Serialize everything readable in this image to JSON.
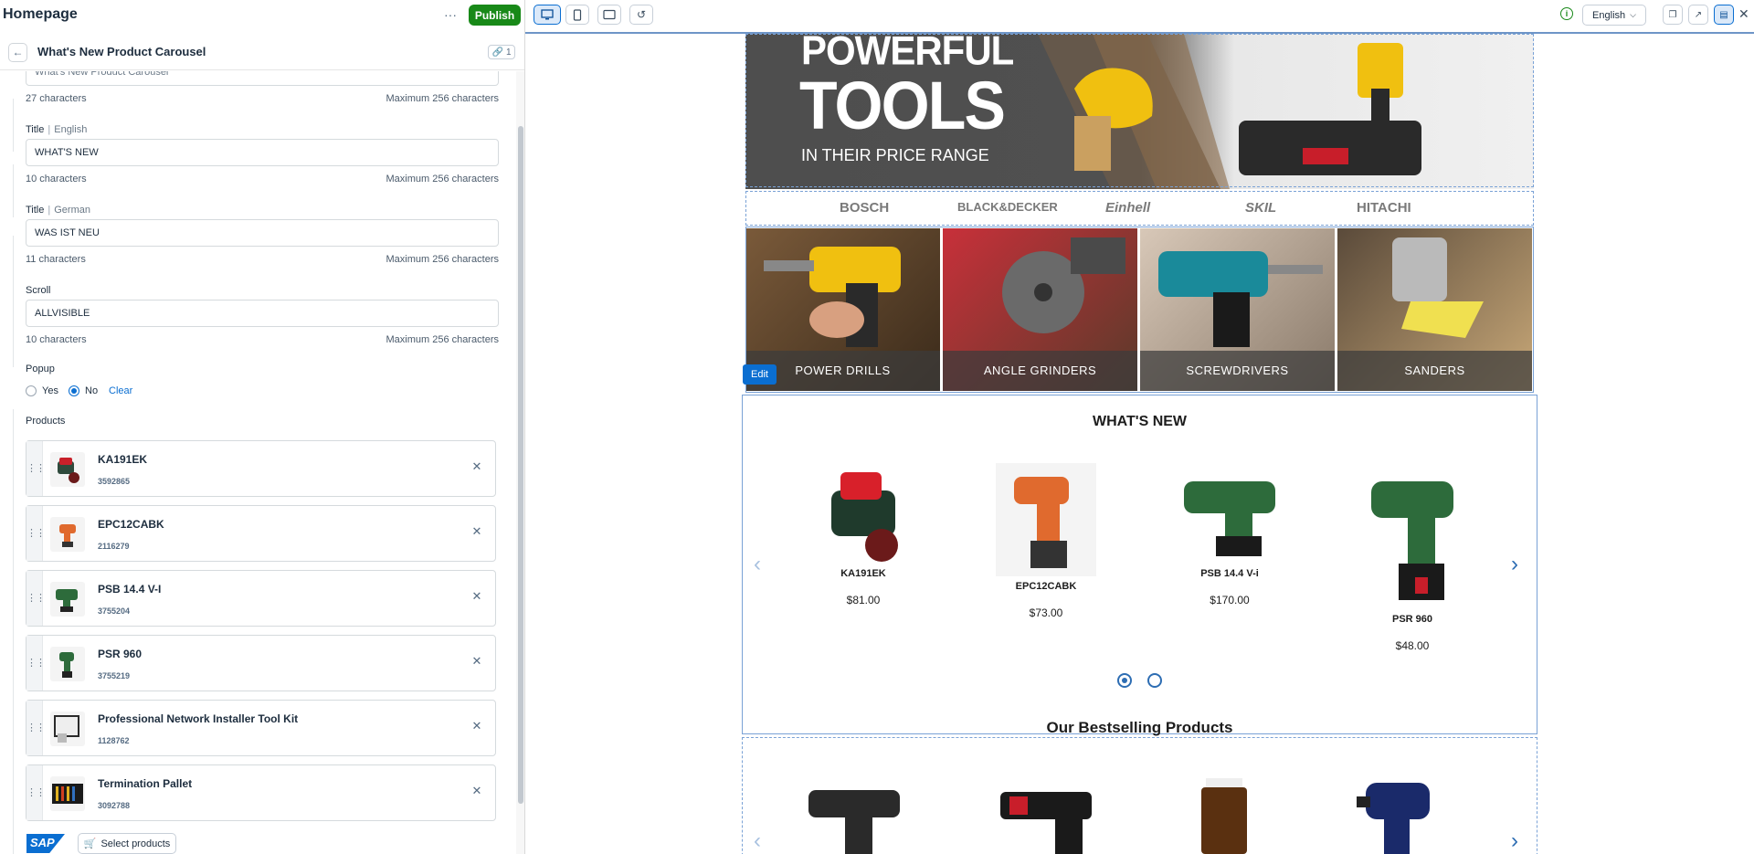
{
  "header": {
    "page_title": "Homepage",
    "more_label": "···",
    "publish_label": "Publish"
  },
  "component": {
    "title": "What's New Product Carousel",
    "link_count": "1"
  },
  "form": {
    "name_value": "What's New Product Carousel",
    "name_count": "27 characters",
    "max_label": "Maximum 256 characters",
    "title_en": {
      "label": "Title",
      "lang": "English",
      "value": "WHAT'S NEW",
      "count": "10 characters"
    },
    "title_de": {
      "label": "Title",
      "lang": "German",
      "value": "WAS IST NEU",
      "count": "11 characters"
    },
    "scroll": {
      "label": "Scroll",
      "value": "ALLVISIBLE",
      "count": "10 characters"
    },
    "popup": {
      "label": "Popup",
      "yes": "Yes",
      "no": "No",
      "clear": "Clear",
      "selected": "No"
    },
    "products_label": "Products",
    "products": [
      {
        "name": "KA191EK",
        "id": "3592865"
      },
      {
        "name": "EPC12CABK",
        "id": "2116279"
      },
      {
        "name": "PSB 14.4 V-I",
        "id": "3755204"
      },
      {
        "name": "PSR 960",
        "id": "3755219"
      },
      {
        "name": "Professional Network Installer Tool Kit",
        "id": "1128762"
      },
      {
        "name": "Termination Pallet",
        "id": "3092788"
      }
    ],
    "sap_logo": "SAP",
    "select_products_label": "Select products"
  },
  "toolbar": {
    "language": "English",
    "view_modes": [
      "desktop-icon",
      "mobile-icon",
      "tablet-icon"
    ],
    "active_view": "desktop"
  },
  "preview": {
    "hero": {
      "line1": "POWERFUL",
      "line2": "TOOLS",
      "line3": "IN THEIR PRICE RANGE"
    },
    "brands": [
      "BOSCH",
      "BLACK&DECKER",
      "Einhell",
      "SKIL",
      "HITACHI"
    ],
    "categories": [
      "POWER DRILLS",
      "ANGLE GRINDERS",
      "SCREWDRIVERS",
      "SANDERS"
    ],
    "edit_label": "Edit",
    "whats_new": {
      "title": "WHAT'S NEW",
      "products": [
        {
          "name": "KA191EK",
          "price": "$81.00"
        },
        {
          "name": "EPC12CABK",
          "price": "$73.00"
        },
        {
          "name": "PSB 14.4 V-i",
          "price": "$170.00"
        },
        {
          "name": "PSR 960",
          "price": "$48.00"
        }
      ],
      "page_dots": 2,
      "active_page": 1
    },
    "bestselling": {
      "title": "Our Bestselling Products"
    }
  },
  "colors": {
    "publish": "#188918",
    "accent": "#0a6ed1",
    "carousel_accent": "#2d6db3"
  }
}
